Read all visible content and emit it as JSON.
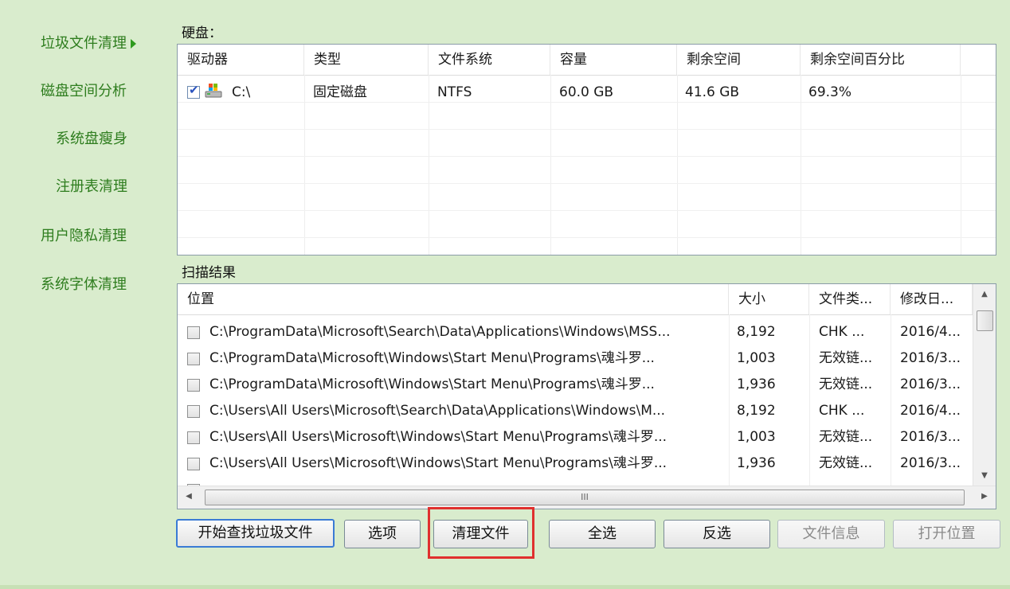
{
  "sidebar": {
    "items": [
      {
        "label": "垃圾文件清理",
        "active": true
      },
      {
        "label": "磁盘空间分析"
      },
      {
        "label": "系统盘瘦身"
      },
      {
        "label": "注册表清理"
      },
      {
        "label": "用户隐私清理"
      },
      {
        "label": "系统字体清理"
      }
    ]
  },
  "disk": {
    "section_label": "硬盘：",
    "columns": [
      "驱动器",
      "类型",
      "文件系统",
      "容量",
      "剩余空间",
      "剩余空间百分比"
    ],
    "rows": [
      {
        "drive": "C:\\",
        "type": "固定磁盘",
        "fs": "NTFS",
        "capacity": "60.0 GB",
        "free": "41.6 GB",
        "percent": "69.3%",
        "checked": true
      }
    ]
  },
  "scan": {
    "section_label": "扫描结果",
    "columns": [
      "位置",
      "大小",
      "文件类...",
      "修改日..."
    ],
    "rows": [
      {
        "path": "C:\\ProgramData\\Microsoft\\Search\\Data\\Applications\\Windows\\MSS...",
        "size": "8,192",
        "type": "CHK ...",
        "date": "2016/4..."
      },
      {
        "path": "C:\\ProgramData\\Microsoft\\Windows\\Start Menu\\Programs\\魂斗罗...",
        "size": "1,003",
        "type": "无效链...",
        "date": "2016/3..."
      },
      {
        "path": "C:\\ProgramData\\Microsoft\\Windows\\Start Menu\\Programs\\魂斗罗...",
        "size": "1,936",
        "type": "无效链...",
        "date": "2016/3..."
      },
      {
        "path": "C:\\Users\\All Users\\Microsoft\\Search\\Data\\Applications\\Windows\\M...",
        "size": "8,192",
        "type": "CHK ...",
        "date": "2016/4..."
      },
      {
        "path": "C:\\Users\\All Users\\Microsoft\\Windows\\Start Menu\\Programs\\魂斗罗...",
        "size": "1,003",
        "type": "无效链...",
        "date": "2016/3..."
      },
      {
        "path": "C:\\Users\\All Users\\Microsoft\\Windows\\Start Menu\\Programs\\魂斗罗...",
        "size": "1,936",
        "type": "无效链...",
        "date": "2016/3..."
      }
    ],
    "hscroll_grip": "III"
  },
  "buttons": {
    "start_scan": "开始查找垃圾文件",
    "options": "选项",
    "clean": "清理文件",
    "select_all": "全选",
    "invert": "反选",
    "file_info": "文件信息",
    "open_location": "打开位置"
  },
  "colors": {
    "background": "#d9eccd",
    "nav_text": "#2e7d1e",
    "highlight": "#e0302e"
  }
}
